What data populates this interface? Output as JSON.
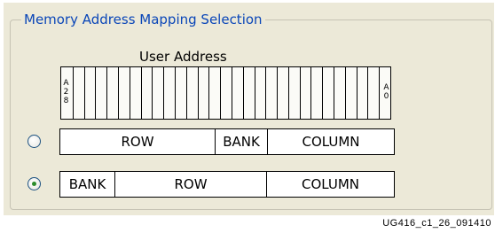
{
  "group": {
    "title": "Memory Address Mapping Selection"
  },
  "address_bar": {
    "label": "User Address",
    "msb_label": "A28",
    "lsb_label": "A0"
  },
  "mappings": [
    {
      "selected": false,
      "fields": [
        "ROW",
        "BANK",
        "COLUMN"
      ]
    },
    {
      "selected": true,
      "fields": [
        "BANK",
        "ROW",
        "COLUMN"
      ]
    }
  ],
  "caption": "UG416_c1_26_091410"
}
